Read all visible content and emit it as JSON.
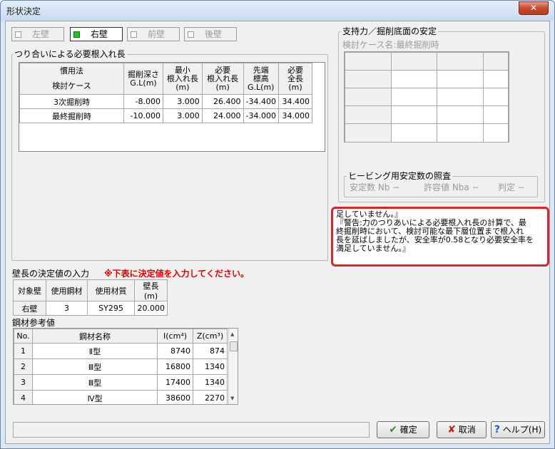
{
  "window": {
    "title": "形状決定",
    "close_glyph": "✕"
  },
  "wall_tabs": [
    {
      "label": "左壁",
      "active": false
    },
    {
      "label": "右壁",
      "active": true
    },
    {
      "label": "前壁",
      "active": false
    },
    {
      "label": "後壁",
      "active": false
    }
  ],
  "embedment": {
    "group_label": "つり合いによる必要根入れ長",
    "method_header": "慣用法",
    "case_header": "検討ケース",
    "col_excavation": "掘削深さ",
    "col_excavation_unit": "G.L(m)",
    "col_min": "最小",
    "col_min2": "根入れ長",
    "col_min_unit": "(m)",
    "col_req": "必要",
    "col_req2": "根入れ長",
    "col_req_unit": "(m)",
    "col_tip": "先端",
    "col_tip2": "標高",
    "col_tip_unit": "G.L(m)",
    "col_total": "必要",
    "col_total2": "全長",
    "col_total_unit": "(m)",
    "rows": [
      {
        "case": "3次掘削時",
        "excavation": "-8.000",
        "min": "3.000",
        "req": "26.400",
        "tip": "-34.400",
        "total": "34.400"
      },
      {
        "case": "最終掘削時",
        "excavation": "-10.000",
        "min": "3.000",
        "req": "24.000",
        "tip": "-34.000",
        "total": "34.000"
      }
    ]
  },
  "bearing": {
    "group_label": "支持力／掘削底面の安定",
    "case_label": "検討ケース名:最終掘削時"
  },
  "heaving": {
    "group_label": "ヒービング用安定数の照査",
    "stability": "安定数 Nb −",
    "allowable": "許容値 Nba −",
    "judgement": "判定 −"
  },
  "warning": {
    "line1": "足していません。』",
    "line2": "『警告:力のつりあいによる必要根入れ長の計算で、最",
    "line3": "終掘削時において、検討可能な最下層位置まで根入れ",
    "line4": "長を延ばしましたが、安全率が0.58となり必要安全率を",
    "line5": "満足していません。』"
  },
  "wall_length": {
    "label": "壁長の決定値の入力",
    "note": "※下表に決定値を入力してください。",
    "headers": {
      "wall": "対象壁",
      "steel": "使用鋼材",
      "material": "使用材質",
      "length": "壁長(m)"
    },
    "row": {
      "wall": "右壁",
      "steel": "3",
      "material": "SY295",
      "length": "20.000"
    }
  },
  "steel_ref": {
    "label": "鋼材参考値",
    "headers": {
      "no": "No.",
      "name": "鋼材名称",
      "I": "I(cm⁴)",
      "Z": "Z(cm³)"
    },
    "rows": [
      {
        "no": "1",
        "name": "Ⅱ型",
        "I": "8740",
        "Z": "874"
      },
      {
        "no": "2",
        "name": "Ⅲ型",
        "I": "16800",
        "Z": "1340"
      },
      {
        "no": "3",
        "name": "Ⅲ型",
        "I": "17400",
        "Z": "1340"
      },
      {
        "no": "4",
        "name": "Ⅳ型",
        "I": "38600",
        "Z": "2270"
      }
    ]
  },
  "buttons": {
    "ok": "確定",
    "cancel": "取消",
    "help": "ヘルプ(H)"
  }
}
